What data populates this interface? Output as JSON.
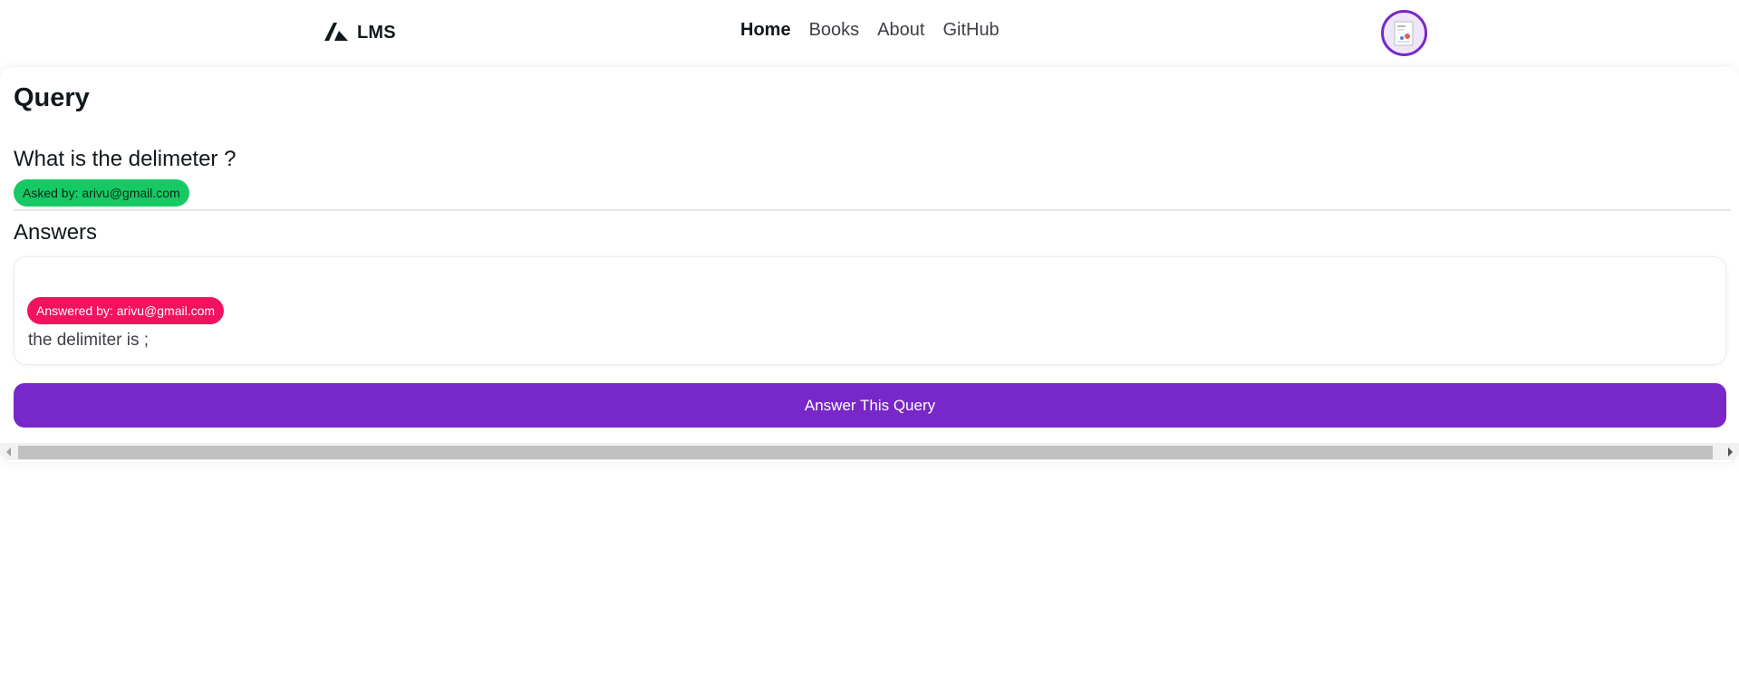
{
  "navbar": {
    "brand": "LMS",
    "links": [
      {
        "label": "Home",
        "active": true
      },
      {
        "label": "Books",
        "active": false
      },
      {
        "label": "About",
        "active": false
      },
      {
        "label": "GitHub",
        "active": false
      }
    ],
    "avatar_icon": "user-avatar"
  },
  "query": {
    "page_title": "Query",
    "question": "What is the delimeter ?",
    "asked_by": "Asked by: arivu@gmail.com"
  },
  "answers": {
    "heading": "Answers",
    "items": [
      {
        "answered_by": "Answered by: arivu@gmail.com",
        "text": "the delimiter is ;"
      }
    ]
  },
  "actions": {
    "answer_button": "Answer This Query"
  },
  "colors": {
    "primary": "#7828c8",
    "success_chip": "#17c964",
    "danger_chip": "#f31260",
    "text": "#11181c"
  }
}
